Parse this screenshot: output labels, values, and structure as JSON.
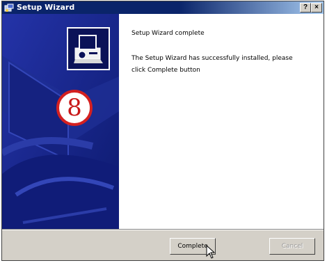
{
  "window": {
    "title": "Setup Wizard",
    "help_button_label": "?",
    "close_button_label": "×"
  },
  "banner": {
    "step_number": "8",
    "colors": {
      "banner": "#1a2a8c",
      "badge_ring": "#d42020"
    }
  },
  "content": {
    "heading": "Setup Wizard complete",
    "message_line1": "The Setup Wizard has successfully installed, please",
    "message_line2": "click Complete button"
  },
  "footer": {
    "complete_label": "Complete",
    "cancel_label": "Cancel"
  }
}
